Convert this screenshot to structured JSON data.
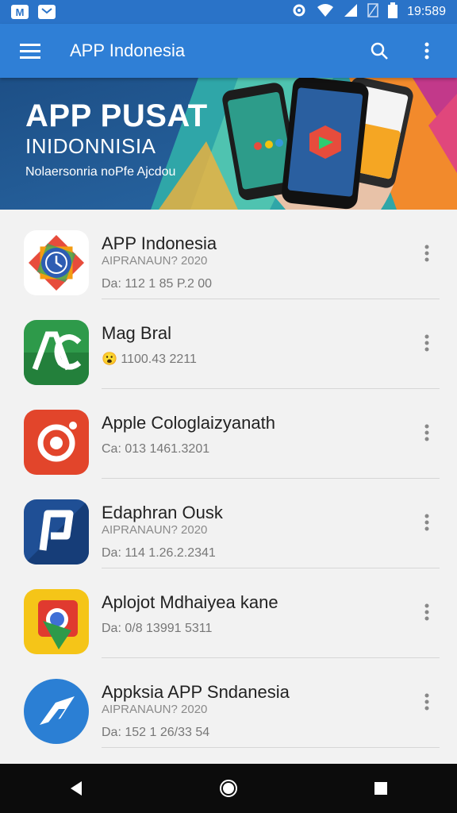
{
  "status_bar": {
    "time": "19:589",
    "left_icons": [
      "M",
      "mail"
    ]
  },
  "app_bar": {
    "title": "APP Indonesia"
  },
  "banner": {
    "title": "APP PUSAT",
    "subtitle": "INIDONNISIA",
    "tagline": "Nolaersonria noPfe Ajcdou"
  },
  "apps": [
    {
      "name": "APP Indonesia",
      "sub": "AIPRANAUN? 2020",
      "date": "Da: 112 1 85 P.2 00"
    },
    {
      "name": "Mag Bral",
      "sub": "",
      "date": "😮 1100.43 2211"
    },
    {
      "name": "Apple Cologlaizyanath",
      "sub": "",
      "date": "Ca: 013 1461.3201"
    },
    {
      "name": "Edaphran Ousk",
      "sub": "AIPRANAUN? 2020",
      "date": "Da: 114 1.26.2.2341"
    },
    {
      "name": "Aplojot Mdhaiyea kane",
      "sub": "",
      "date": "Da: 0/8 13991 5311"
    },
    {
      "name": "Appksia APP Sndanesia",
      "sub": "AIPRANAUN? 2020",
      "date": "Da: 152 1 26/33 54"
    }
  ],
  "colors": {
    "status_bar": "#2a73c8",
    "app_bar": "#2f7fd6",
    "nav_bar": "#0c0c0c"
  }
}
